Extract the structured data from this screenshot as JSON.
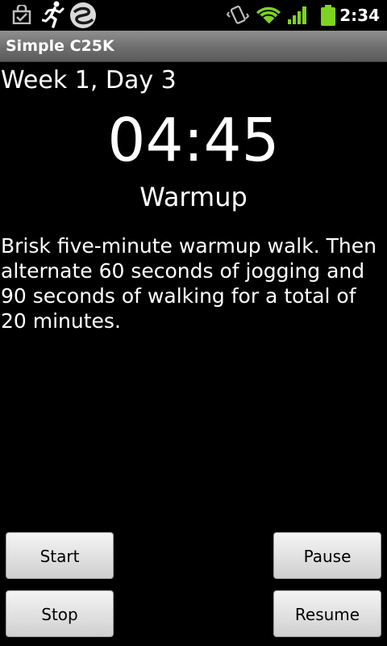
{
  "status_bar": {
    "time": "2:34",
    "icons": [
      "shopping-bag-icon",
      "runner-icon",
      "swirl-app-icon",
      "vibrate-icon",
      "wifi-icon",
      "signal-icon",
      "battery-icon"
    ]
  },
  "app": {
    "title": "Simple C25K"
  },
  "workout": {
    "week_day": "Week 1, Day 3",
    "timer": "04:45",
    "phase": "Warmup",
    "description": "Brisk five-minute warmup walk. Then alternate 60 seconds of jogging and 90 seconds of walking for a total of 20 minutes."
  },
  "controls": {
    "start_label": "Start",
    "stop_label": "Stop",
    "pause_label": "Pause",
    "resume_label": "Resume"
  },
  "colors": {
    "background": "#000000",
    "text": "#ffffff",
    "wifi": "#7ed321",
    "signal": "#7ed321",
    "battery": "#7ed321"
  }
}
